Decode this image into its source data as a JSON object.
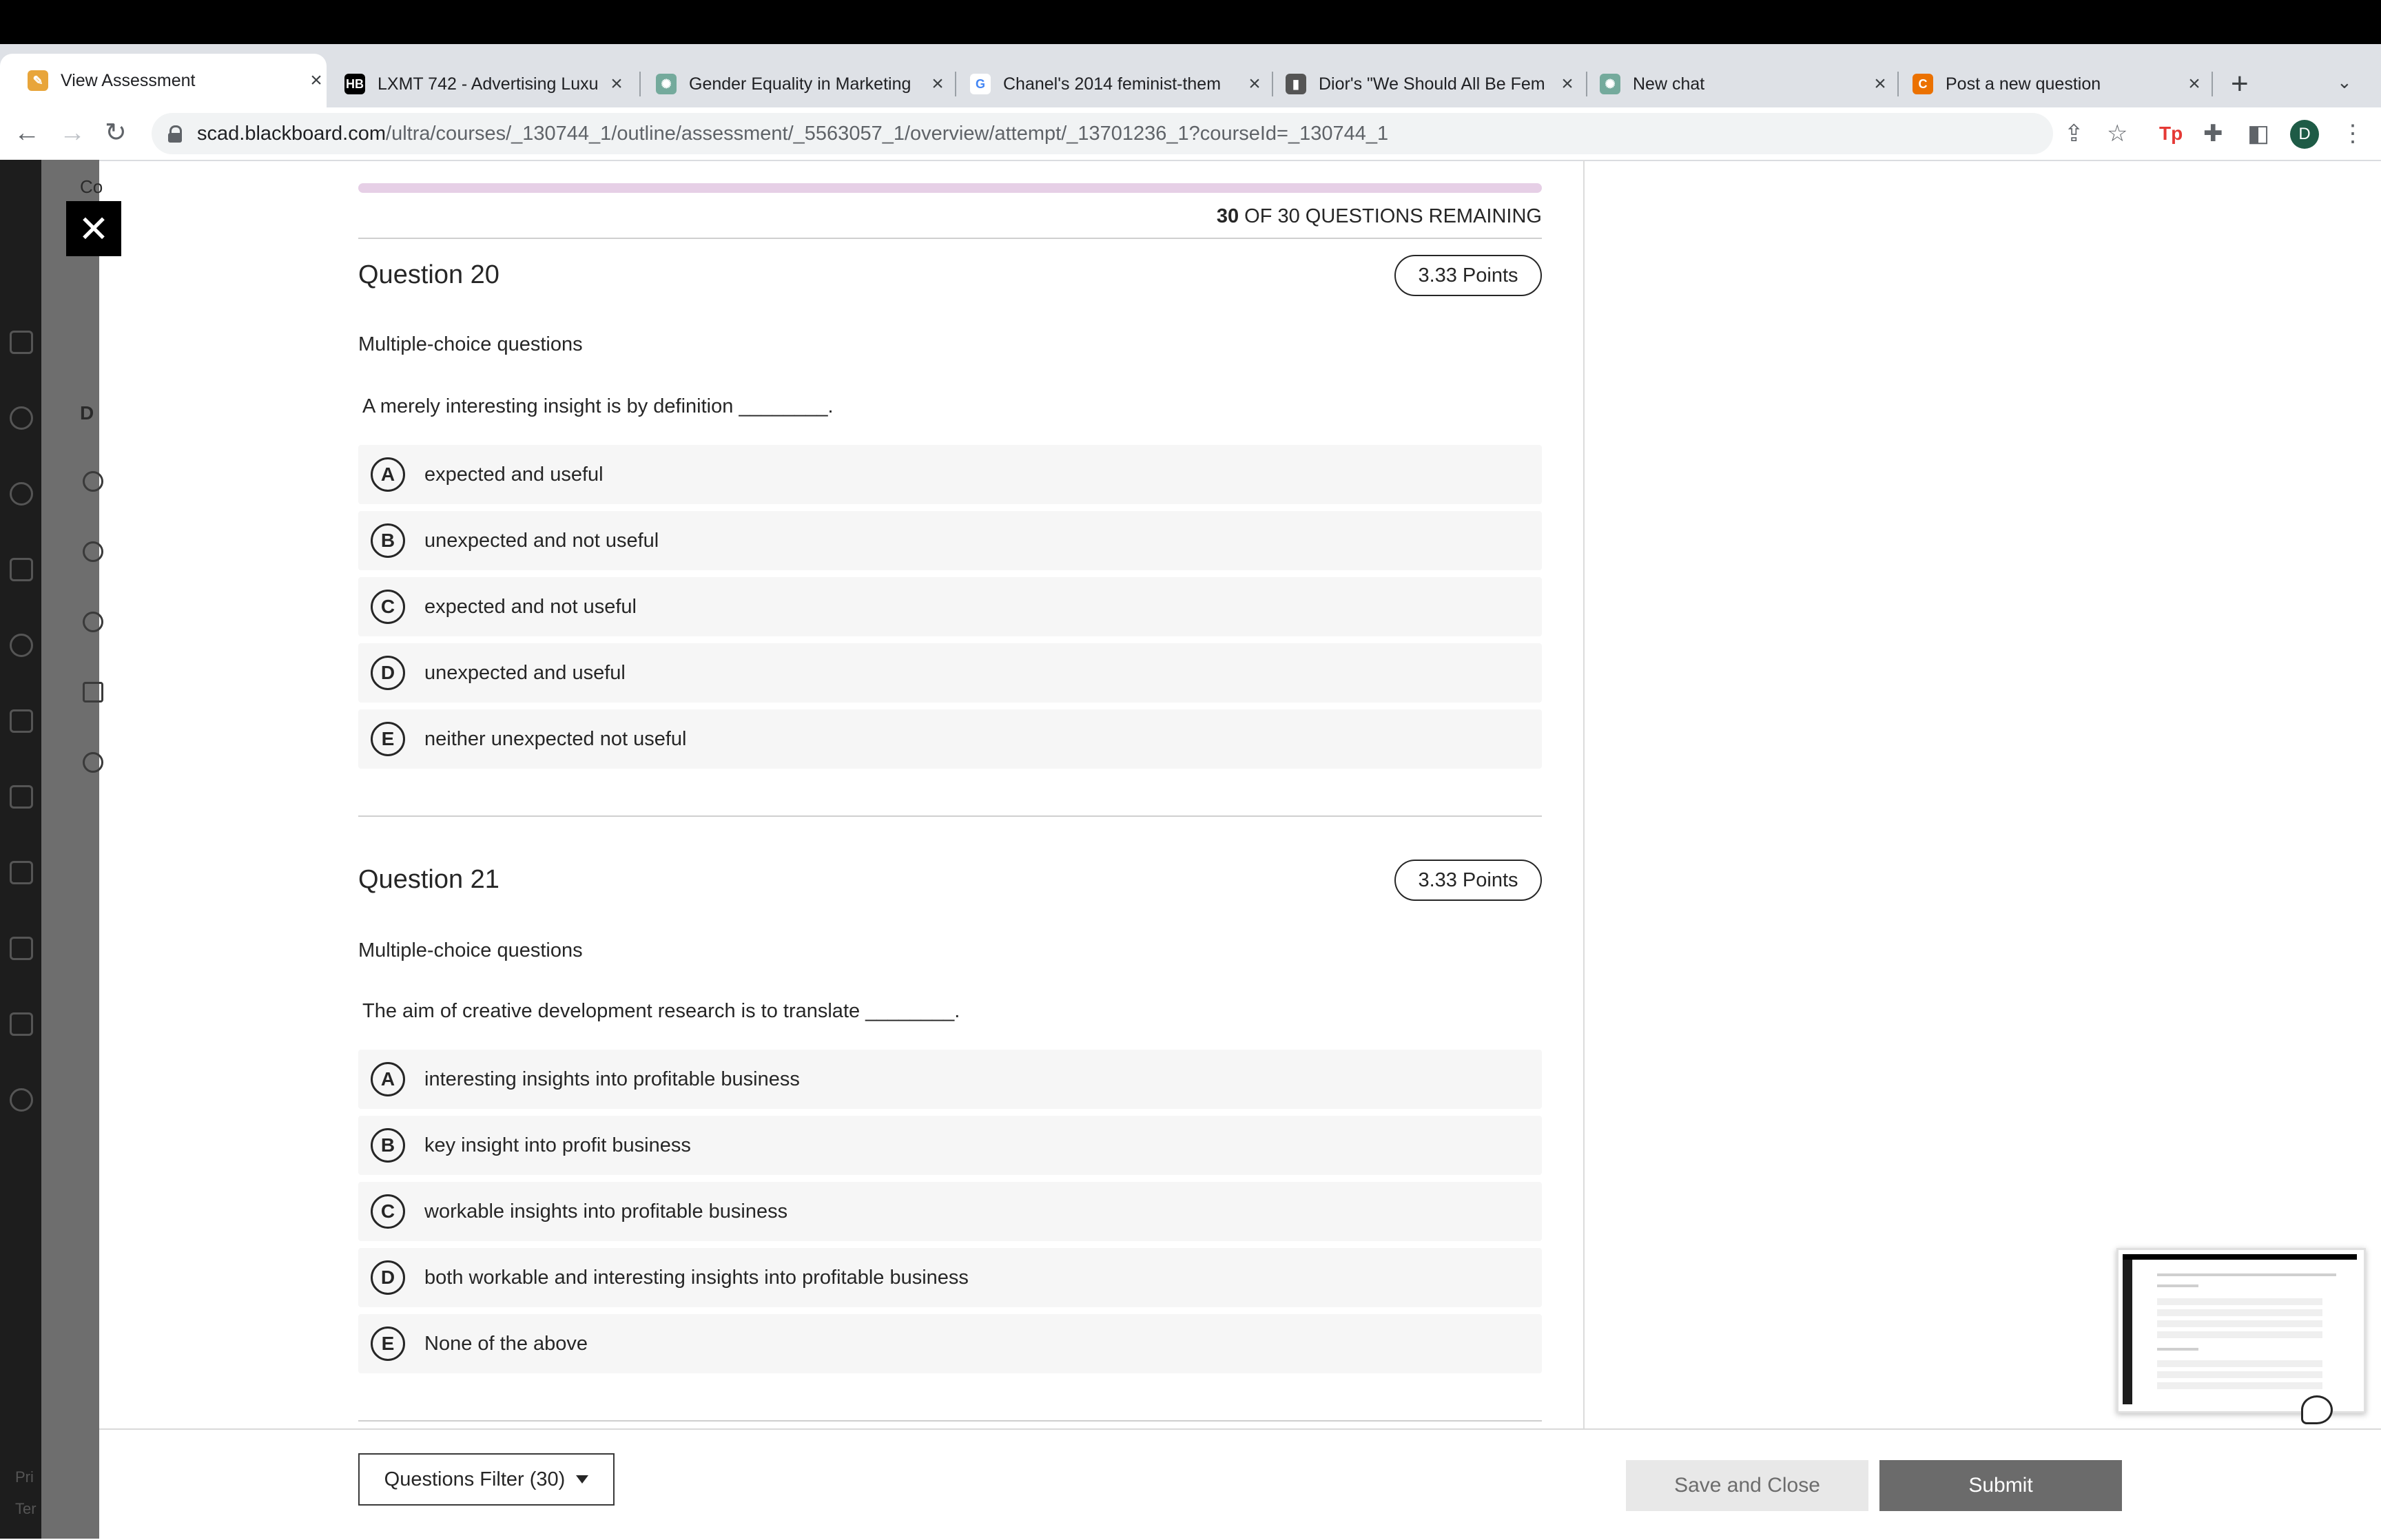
{
  "browser": {
    "tabs": [
      {
        "title": "View Assessment",
        "icon": "blackboard-pencil-icon",
        "color": "#e8a53a",
        "active": true
      },
      {
        "title": "LXMT 742 - Advertising Luxu",
        "icon": "hb-icon",
        "color": "#000000"
      },
      {
        "title": "Gender Equality in Marketing",
        "icon": "chatgpt-icon",
        "color": "#74aa9c"
      },
      {
        "title": "Chanel's 2014 feminist-them",
        "icon": "google-icon",
        "color": "#4285f4"
      },
      {
        "title": "Dior's \"We Should All Be Fem",
        "icon": "site-icon",
        "color": "#555555"
      },
      {
        "title": "New chat",
        "icon": "chatgpt-icon",
        "color": "#74aa9c"
      },
      {
        "title": "Post a new question",
        "icon": "chegg-icon",
        "color": "#eb7100"
      }
    ],
    "new_tab": "+",
    "url_host": "scad.blackboard.com",
    "url_path": "/ultra/courses/_130744_1/outline/assessment/_5563057_1/overview/attempt/_13701236_1?courseId=_130744_1",
    "profile_initial": "D"
  },
  "assessment": {
    "remaining_count": "30",
    "remaining_text": " OF 30 QUESTIONS REMAINING",
    "progress_fraction": 0,
    "questions": [
      {
        "title": "Question 20",
        "points": "3.33 Points",
        "type": "Multiple-choice questions",
        "text": "A merely interesting insight is by definition ________.",
        "options": [
          {
            "letter": "A",
            "text": "expected and useful"
          },
          {
            "letter": "B",
            "text": "unexpected and not useful"
          },
          {
            "letter": "C",
            "text": "expected and not useful"
          },
          {
            "letter": "D",
            "text": "unexpected and useful"
          },
          {
            "letter": "E",
            "text": "neither unexpected not useful"
          }
        ]
      },
      {
        "title": "Question 21",
        "points": "3.33 Points",
        "type": "Multiple-choice questions",
        "text": "The aim of creative development research is to translate ________.",
        "options": [
          {
            "letter": "A",
            "text": "interesting insights into profitable business"
          },
          {
            "letter": "B",
            "text": "key insight into profit business"
          },
          {
            "letter": "C",
            "text": "workable insights into profitable business"
          },
          {
            "letter": "D",
            "text": "both workable and interesting insights into profitable business"
          },
          {
            "letter": "E",
            "text": "None of the above"
          }
        ]
      }
    ]
  },
  "footer": {
    "filter_label": "Questions Filter (30)",
    "save_close_label": "Save and Close",
    "submit_label": "Submit"
  },
  "background": {
    "panel_letters": [
      "Co",
      "D"
    ],
    "sidebar_footer": [
      "Pri",
      "Ter"
    ]
  },
  "colors": {
    "progress_track": "#e6cfe6",
    "submit_bg": "#6b6b6b",
    "save_close_bg": "#e8e8e8"
  }
}
